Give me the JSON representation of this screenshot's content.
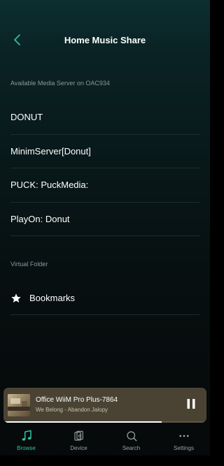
{
  "header": {
    "title": "Home Music Share",
    "back_icon": "chevron-left-icon"
  },
  "server_section": {
    "label": "Available Media Server on OAC934",
    "items": [
      {
        "label": "DONUT"
      },
      {
        "label": "MinimServer[Donut]"
      },
      {
        "label": "PUCK: PuckMedia:"
      },
      {
        "label": "PlayOn: Donut"
      }
    ]
  },
  "virtual_section": {
    "label": "Virtual Folder",
    "items": [
      {
        "label": "Bookmarks",
        "icon": "star-icon"
      }
    ]
  },
  "now_playing": {
    "device": "Office WiiM Pro Plus-7864",
    "track": "We Belong - Abandon Jalopy",
    "progress": 0.78,
    "control_icon": "pause-icon"
  },
  "tabs": [
    {
      "label": "Browse",
      "icon": "music-note-icon",
      "active": true
    },
    {
      "label": "Device",
      "icon": "speaker-icon",
      "active": false
    },
    {
      "label": "Search",
      "icon": "search-icon",
      "active": false
    },
    {
      "label": "Settings",
      "icon": "more-dots-icon",
      "active": false
    }
  ],
  "colors": {
    "accent": "#2ec4a5",
    "player_bg": "#4a4334",
    "background_top": "#0d2e30",
    "background_bottom": "#060909"
  }
}
